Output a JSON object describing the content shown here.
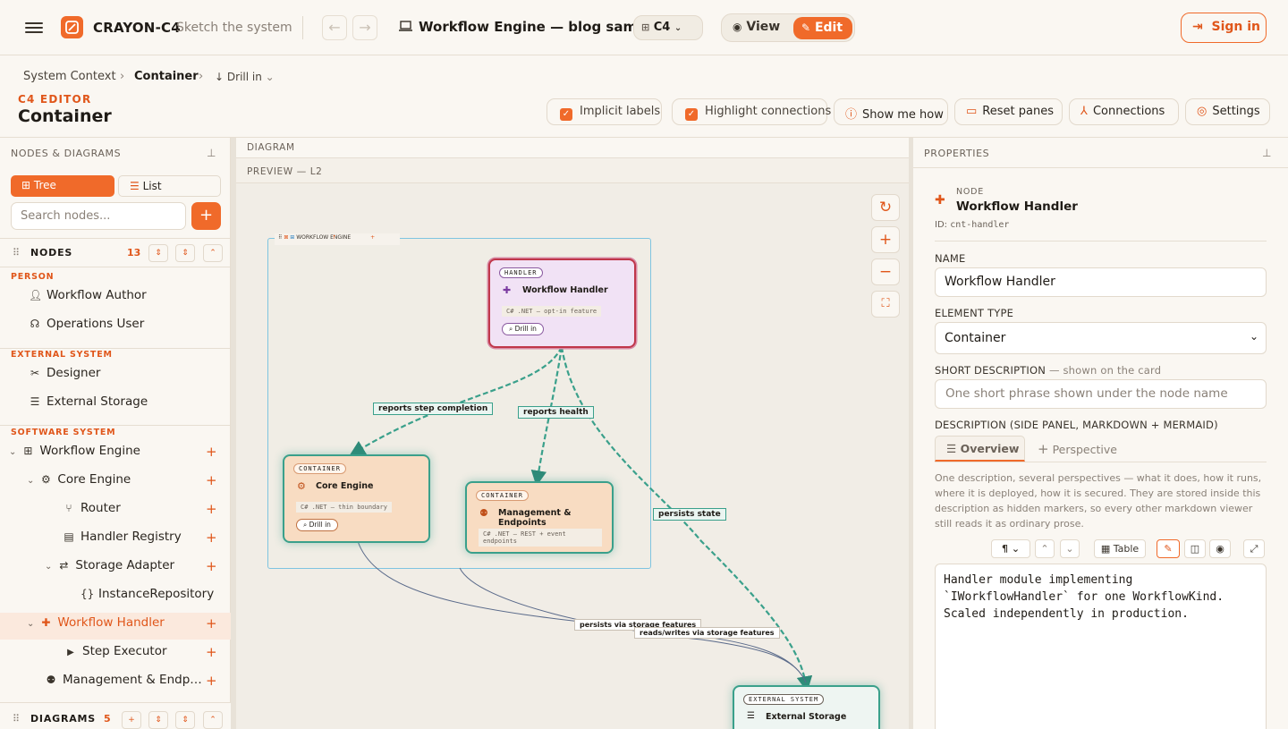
{
  "header": {
    "app_name": "CRAYON-C4",
    "tagline": "Sketch the system",
    "doc_title": "Workflow Engine — blog sam…",
    "notation": "C4",
    "view_label": "View",
    "edit_label": "Edit",
    "sign_in": "Sign in"
  },
  "breadcrumb": [
    "System Context",
    "Container",
    "Drill in"
  ],
  "editor": {
    "subtitle": "C4 EDITOR",
    "title": "Container"
  },
  "toolbar": {
    "implicit_labels": "Implicit labels",
    "highlight_connections": "Highlight connections",
    "show_me_how": "Show me how",
    "reset_panes": "Reset panes",
    "connections": "Connections",
    "settings": "Settings"
  },
  "left_panel": {
    "title": "NODES & DIAGRAMS",
    "tab_tree": "Tree",
    "tab_list": "List",
    "search_placeholder": "Search nodes...",
    "nodes_label": "NODES",
    "nodes_count": "13",
    "diagrams_label": "DIAGRAMS",
    "diagrams_count": "5",
    "groups": {
      "person": "PERSON",
      "external": "EXTERNAL SYSTEM",
      "software": "SOFTWARE SYSTEM"
    },
    "items": {
      "workflow_author": "Workflow Author",
      "operations_user": "Operations User",
      "designer": "Designer",
      "external_storage": "External Storage",
      "workflow_engine": "Workflow Engine",
      "core_engine": "Core Engine",
      "router": "Router",
      "handler_registry": "Handler Registry",
      "storage_adapter": "Storage Adapter",
      "instance_repository": "InstanceRepository",
      "workflow_handler": "Workflow Handler",
      "step_executor": "Step Executor",
      "management": "Management & Endp…"
    }
  },
  "diagram": {
    "header": "DIAGRAM",
    "preview": "PREVIEW — L2",
    "boundary_label": "WORKFLOW ENGINE",
    "nodes": {
      "handler": {
        "kind": "HANDLER",
        "name": "Workflow Handler",
        "tech": "C# .NET — opt-in feature",
        "drill": "Drill in"
      },
      "core": {
        "kind": "CONTAINER",
        "name": "Core Engine",
        "tech": "C# .NET — thin boundary",
        "drill": "Drill in"
      },
      "mgmt": {
        "kind": "CONTAINER",
        "name": "Management & Endpoints",
        "tech": "C# .NET — REST + event endpoints"
      },
      "storage": {
        "kind": "EXTERNAL SYSTEM",
        "name": "External Storage"
      }
    },
    "edges": {
      "e1": "reports step completion",
      "e2": "reports health",
      "e3": "persists state",
      "e4": "persists via storage features",
      "e5": "reads/writes via storage features"
    }
  },
  "properties": {
    "header": "PROPERTIES",
    "node_kind": "NODE",
    "node_name": "Workflow Handler",
    "node_id_label": "ID:",
    "node_id": "cnt-handler",
    "name_label": "NAME",
    "name_value": "Workflow Handler",
    "type_label": "ELEMENT TYPE",
    "type_value": "Container",
    "short_desc_label": "SHORT DESCRIPTION",
    "short_desc_hint": "— shown on the card",
    "short_desc_placeholder": "One short phrase shown under the node name",
    "desc_label": "DESCRIPTION (SIDE PANEL, MARKDOWN + MERMAID)",
    "tab_overview": "Overview",
    "tab_perspective": "Perspective",
    "help_text": "One description, several perspectives — what it does, how it runs, where it is deployed, how it is secured. They are stored inside this description as hidden markers, so every other markdown viewer still reads it as ordinary prose.",
    "table_btn": "Table",
    "paragraph_btn": "¶",
    "desc_line1": "Handler module implementing",
    "desc_line2": "`IWorkflowHandler` for one WorkflowKind.",
    "desc_line3": "Scaled independently in production."
  },
  "colors": {
    "accent": "#f06a2a",
    "teal": "#3aa08b",
    "handler_bg": "#f1e2f5",
    "handler_border": "#c0374a"
  }
}
